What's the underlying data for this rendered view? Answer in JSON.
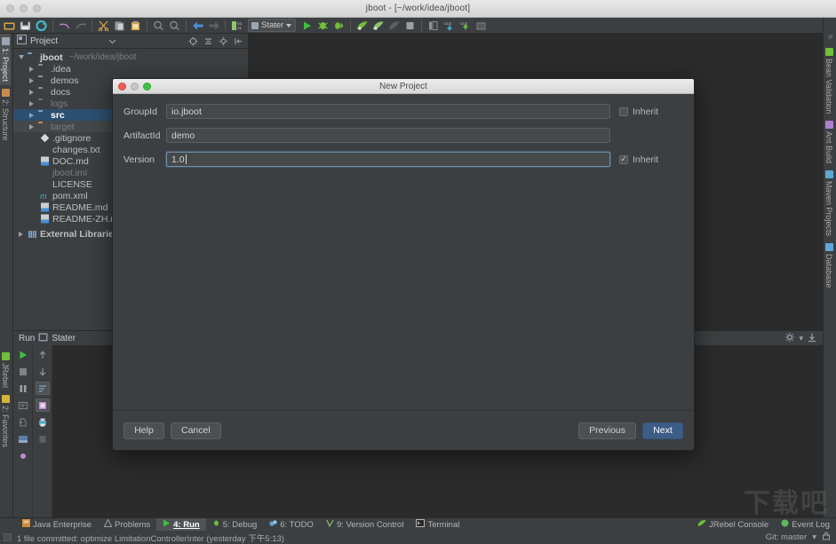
{
  "window": {
    "title": "jboot - [~/work/idea/jboot]"
  },
  "toolbar": {
    "run_config": "Stater",
    "items": [
      {
        "name": "open-icon",
        "label": "Open"
      },
      {
        "name": "save-icon",
        "label": "Save All"
      },
      {
        "name": "sync-icon",
        "label": "Synchronize"
      },
      {
        "name": "undo-icon",
        "label": "Undo"
      },
      {
        "name": "redo-icon",
        "label": "Redo"
      },
      {
        "name": "cut-icon",
        "label": "Cut"
      },
      {
        "name": "copy-icon",
        "label": "Copy"
      },
      {
        "name": "paste-icon",
        "label": "Paste"
      },
      {
        "name": "find-icon",
        "label": "Find"
      },
      {
        "name": "replace-icon",
        "label": "Replace"
      },
      {
        "name": "back-icon",
        "label": "Back"
      },
      {
        "name": "forward-icon",
        "label": "Forward"
      },
      {
        "name": "compile-icon",
        "label": "Compile"
      },
      {
        "name": "run-icon",
        "label": "Run"
      },
      {
        "name": "debug-icon",
        "label": "Debug"
      },
      {
        "name": "run-coverage-icon",
        "label": "Run with Coverage"
      },
      {
        "name": "jrebel-run-icon",
        "label": "Run with JRebel"
      },
      {
        "name": "jrebel-debug-icon",
        "label": "Debug with JRebel"
      },
      {
        "name": "jrebel-profile-icon",
        "label": "Profile with JRebel"
      },
      {
        "name": "stop-icon",
        "label": "Stop"
      },
      {
        "name": "settings-icon",
        "label": "Settings"
      },
      {
        "name": "vcs-update-icon",
        "label": "Update Project"
      },
      {
        "name": "vcs-commit-icon",
        "label": "Commit"
      },
      {
        "name": "vcs-history-icon",
        "label": "History"
      }
    ]
  },
  "project_panel": {
    "title": "Project",
    "header_icons": [
      {
        "name": "locate-icon",
        "label": "Select Opened File"
      },
      {
        "name": "collapse-all-icon",
        "label": "Collapse All"
      },
      {
        "name": "gear-icon",
        "label": "Settings"
      },
      {
        "name": "hide-icon",
        "label": "Hide"
      }
    ],
    "tree": [
      {
        "label": "jboot",
        "path": "~/work/idea/jboot",
        "indent": 0,
        "twisty": "down",
        "icon": "module",
        "style": "bold"
      },
      {
        "label": ".idea",
        "indent": 1,
        "twisty": "right",
        "icon": "folder",
        "style": "normal"
      },
      {
        "label": "demos",
        "indent": 1,
        "twisty": "right",
        "icon": "folder",
        "style": "normal"
      },
      {
        "label": "docs",
        "indent": 1,
        "twisty": "right",
        "icon": "folder",
        "style": "normal"
      },
      {
        "label": "logs",
        "indent": 1,
        "twisty": "right",
        "icon": "folder",
        "style": "dim"
      },
      {
        "label": "src",
        "indent": 1,
        "twisty": "right",
        "icon": "folder",
        "style": "selected"
      },
      {
        "label": "target",
        "indent": 1,
        "twisty": "right",
        "icon": "folder-orange",
        "style": "dim-row"
      },
      {
        "label": ".gitignore",
        "indent": 2,
        "twisty": "none",
        "icon": "gitignore",
        "style": "normal"
      },
      {
        "label": "changes.txt",
        "indent": 2,
        "twisty": "none",
        "icon": "text",
        "style": "normal"
      },
      {
        "label": "DOC.md",
        "indent": 2,
        "twisty": "none",
        "icon": "markdown",
        "style": "normal"
      },
      {
        "label": "jboot.iml",
        "indent": 2,
        "twisty": "none",
        "icon": "iml",
        "style": "dim"
      },
      {
        "label": "LICENSE",
        "indent": 2,
        "twisty": "none",
        "icon": "text",
        "style": "normal"
      },
      {
        "label": "pom.xml",
        "indent": 2,
        "twisty": "none",
        "icon": "maven",
        "style": "normal"
      },
      {
        "label": "README.md",
        "indent": 2,
        "twisty": "none",
        "icon": "markdown",
        "style": "normal"
      },
      {
        "label": "README-ZH.md",
        "indent": 2,
        "twisty": "none",
        "icon": "markdown",
        "style": "normal"
      },
      {
        "label": "External Libraries",
        "indent": 0,
        "twisty": "right",
        "icon": "libraries",
        "style": "normal"
      }
    ]
  },
  "left_strip": {
    "tabs": [
      {
        "label": "1: Project",
        "name": "tool-tab-project",
        "selected": true,
        "color": "#9aa6b4"
      },
      {
        "label": "2: Structure",
        "name": "tool-tab-structure",
        "selected": false,
        "color": "#c58b4e"
      }
    ],
    "bottom_tabs": [
      {
        "label": "JRebel",
        "name": "tool-tab-jrebel",
        "color": "#6fbf3a"
      },
      {
        "label": "2: Favorites",
        "name": "tool-tab-favorites",
        "color": "#d8b33a"
      }
    ]
  },
  "right_strip": {
    "tabs": [
      {
        "label": "Bean Validation",
        "name": "tool-tab-bean-validation",
        "color": "#6fbf3a"
      },
      {
        "label": "Ant Build",
        "name": "tool-tab-ant-build",
        "color": "#b07fd0"
      },
      {
        "label": "Maven Projects",
        "name": "tool-tab-maven-projects",
        "color": "#5fa8d8"
      },
      {
        "label": "Database",
        "name": "tool-tab-database",
        "color": "#5fa8d8"
      }
    ]
  },
  "run_window": {
    "title": "Run",
    "tab": "Stater",
    "gutter_left": [
      {
        "name": "rerun-icon",
        "label": "Rerun"
      },
      {
        "name": "stop-icon",
        "label": "Stop"
      },
      {
        "name": "pause-icon",
        "label": "Pause"
      },
      {
        "name": "dump-threads-icon",
        "label": "Dump Threads"
      },
      {
        "name": "restore-layout-icon",
        "label": "Restore Layout"
      },
      {
        "name": "console-icon",
        "label": "Console"
      }
    ],
    "gutter_right": [
      {
        "name": "arrow-up-icon",
        "label": "Up the Stack Trace"
      },
      {
        "name": "arrow-down-icon",
        "label": "Down the Stack Trace"
      },
      {
        "name": "soft-wrap-icon",
        "label": "Soft-Wrap"
      },
      {
        "name": "scroll-to-end-icon",
        "label": "Scroll to End"
      },
      {
        "name": "print-icon",
        "label": "Print"
      },
      {
        "name": "clear-all-icon",
        "label": "Clear All"
      }
    ],
    "header_icons": [
      {
        "name": "gear-icon",
        "label": "Settings"
      },
      {
        "name": "hide-icon",
        "label": "Hide"
      }
    ]
  },
  "dialog": {
    "title": "New Project",
    "fields": [
      {
        "label": "GroupId",
        "value": "io.jboot",
        "placeholder": "",
        "focused": false,
        "inherit_label": "Inherit",
        "inherit_checked": false,
        "inherit_visible": true
      },
      {
        "label": "ArtifactId",
        "value": "demo",
        "placeholder": "",
        "focused": false,
        "inherit_label": "",
        "inherit_checked": false,
        "inherit_visible": false
      },
      {
        "label": "Version",
        "value": "1.0",
        "placeholder": "",
        "focused": true,
        "inherit_label": "Inherit",
        "inherit_checked": true,
        "inherit_visible": true
      }
    ],
    "buttons": {
      "help": "Help",
      "cancel": "Cancel",
      "previous": "Previous",
      "next": "Next"
    }
  },
  "bottom_tabs": [
    {
      "label": "Java Enterprise",
      "mnemonic": "",
      "name": "bottom-tab-java-enterprise",
      "selected": false,
      "color": "#d08a3e"
    },
    {
      "label": "Problems",
      "mnemonic": "",
      "name": "bottom-tab-problems",
      "selected": false,
      "color": "#a0a0a0"
    },
    {
      "label": "4: Run",
      "mnemonic": "4",
      "name": "bottom-tab-run",
      "selected": true,
      "color": "#5fb85f"
    },
    {
      "label": "5: Debug",
      "mnemonic": "5",
      "name": "bottom-tab-debug",
      "selected": false,
      "color": "#6fbf3a"
    },
    {
      "label": "6: TODO",
      "mnemonic": "6",
      "name": "bottom-tab-todo",
      "selected": false,
      "color": "#5fa8d8"
    },
    {
      "label": "9: Version Control",
      "mnemonic": "9",
      "name": "bottom-tab-version-control",
      "selected": false,
      "color": "#8fc46f"
    },
    {
      "label": "Terminal",
      "mnemonic": "",
      "name": "bottom-tab-terminal",
      "selected": false,
      "color": "#cfcfcf"
    }
  ],
  "bottom_right_tabs": [
    {
      "label": "JRebel Console",
      "name": "bottom-tab-jrebel-console",
      "color": "#6fbf3a"
    },
    {
      "label": "Event Log",
      "name": "bottom-tab-event-log",
      "color": "#5fb85f"
    }
  ],
  "status_bar": {
    "message": "1 file committed: optimize LimitationControllerInter (yesterday 下午5:13)",
    "branch": "Git: master"
  },
  "watermark": "下载吧",
  "colors": {
    "accent": "#3c5d86",
    "selection": "#2d4f70",
    "panel": "#3c3f41",
    "editor": "#2b2b2b",
    "green": "#5fb85f"
  }
}
